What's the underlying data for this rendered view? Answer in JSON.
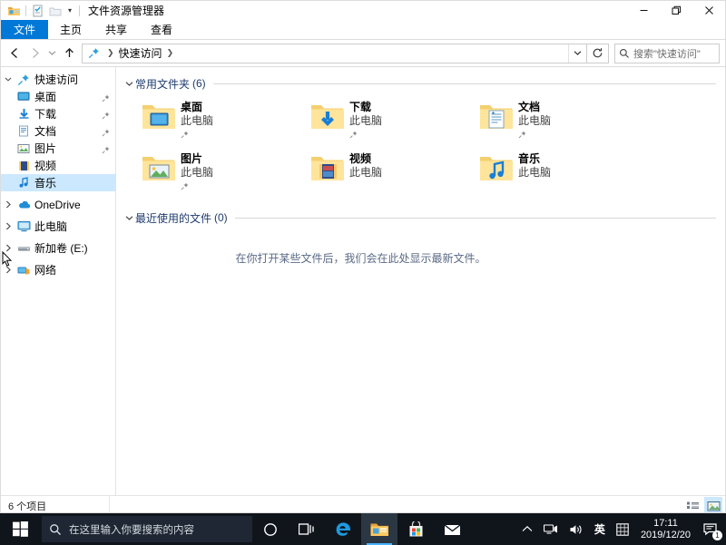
{
  "window": {
    "title": "文件资源管理器",
    "quick_access_toolbar": [
      {
        "icon": "folder-properties-icon",
        "name": "qat-folder-icon"
      },
      {
        "icon": "properties-icon",
        "name": "qat-properties-icon"
      },
      {
        "icon": "new-folder-icon",
        "name": "qat-new-folder-icon"
      }
    ],
    "controls": {
      "minimize": "─",
      "maximize": "❐",
      "close": "✕"
    }
  },
  "ribbon": {
    "tabs": [
      {
        "label": "文件",
        "active": true
      },
      {
        "label": "主页",
        "active": false
      },
      {
        "label": "共享",
        "active": false
      },
      {
        "label": "查看",
        "active": false
      }
    ]
  },
  "navbar": {
    "back": "←",
    "forward": "→",
    "recent": "⌄",
    "up": "↑",
    "breadcrumb": [
      "快速访问"
    ],
    "address_dropdown": "⌄",
    "refresh": "↻",
    "search_placeholder": "搜索\"快速访问\""
  },
  "sidebar": {
    "items": [
      {
        "label": "快速访问",
        "icon": "star-pin-icon",
        "expander": "∨",
        "child": false,
        "pinned": false,
        "selected": false
      },
      {
        "label": "桌面",
        "icon": "desktop-icon",
        "expander": "",
        "child": true,
        "pinned": true,
        "selected": false
      },
      {
        "label": "下载",
        "icon": "download-icon",
        "expander": "",
        "child": true,
        "pinned": true,
        "selected": false
      },
      {
        "label": "文档",
        "icon": "documents-icon",
        "expander": "",
        "child": true,
        "pinned": true,
        "selected": false
      },
      {
        "label": "图片",
        "icon": "pictures-icon",
        "expander": "",
        "child": true,
        "pinned": true,
        "selected": false
      },
      {
        "label": "视频",
        "icon": "videos-icon",
        "expander": "",
        "child": true,
        "pinned": false,
        "selected": false
      },
      {
        "label": "音乐",
        "icon": "music-icon",
        "expander": "",
        "child": true,
        "pinned": false,
        "selected": true
      },
      {
        "label": "OneDrive",
        "icon": "onedrive-icon",
        "expander": "›",
        "child": false,
        "pinned": false,
        "selected": false
      },
      {
        "label": "此电脑",
        "icon": "this-pc-icon",
        "expander": "›",
        "child": false,
        "pinned": false,
        "selected": false
      },
      {
        "label": "新加卷 (E:)",
        "icon": "drive-icon",
        "expander": "›",
        "child": false,
        "pinned": false,
        "selected": false
      },
      {
        "label": "网络",
        "icon": "network-icon",
        "expander": "›",
        "child": false,
        "pinned": false,
        "selected": false
      }
    ]
  },
  "main": {
    "frequent_section": {
      "chevron": "∨",
      "title": "常用文件夹",
      "count": "(6)",
      "items": [
        {
          "name": "桌面",
          "location": "此电脑",
          "icon": "folder-desktop-icon",
          "pinned": true
        },
        {
          "name": "下载",
          "location": "此电脑",
          "icon": "folder-downloads-icon",
          "pinned": true
        },
        {
          "name": "文档",
          "location": "此电脑",
          "icon": "folder-documents-icon",
          "pinned": true
        },
        {
          "name": "图片",
          "location": "此电脑",
          "icon": "folder-pictures-icon",
          "pinned": true
        },
        {
          "name": "视频",
          "location": "此电脑",
          "icon": "folder-videos-icon",
          "pinned": false
        },
        {
          "name": "音乐",
          "location": "此电脑",
          "icon": "folder-music-icon",
          "pinned": false
        }
      ]
    },
    "recent_section": {
      "chevron": "∨",
      "title": "最近使用的文件",
      "count": "(0)",
      "empty_message": "在你打开某些文件后，我们会在此处显示最新文件。"
    }
  },
  "statusbar": {
    "item_count": "6 个项目",
    "views": [
      {
        "name": "details-view-button",
        "active": false
      },
      {
        "name": "large-icons-view-button",
        "active": true
      }
    ]
  },
  "taskbar": {
    "start": "start-icon",
    "search_placeholder": "在这里输入你要搜索的内容",
    "buttons": [
      {
        "name": "cortana-icon",
        "glyph": "○"
      },
      {
        "name": "task-view-icon",
        "glyph": ""
      },
      {
        "name": "edge-icon",
        "glyph": "e"
      },
      {
        "name": "file-explorer-icon",
        "glyph": "",
        "running": true
      },
      {
        "name": "microsoft-store-icon",
        "glyph": ""
      },
      {
        "name": "mail-icon",
        "glyph": "✉"
      }
    ],
    "tray": {
      "show_hidden": "ⱏ",
      "network": "network-tray-icon",
      "volume": "volume-tray-icon",
      "ime": "英",
      "ime_mode": "ime-pad-icon",
      "time": "17:11",
      "date": "2019/12/20",
      "notifications_count": "1"
    }
  },
  "colors": {
    "accent": "#0078d7",
    "selection": "#cce8ff",
    "section_title": "#1f3b6e",
    "taskbar": "#10151c",
    "folder_yellow": "#ffd068"
  }
}
